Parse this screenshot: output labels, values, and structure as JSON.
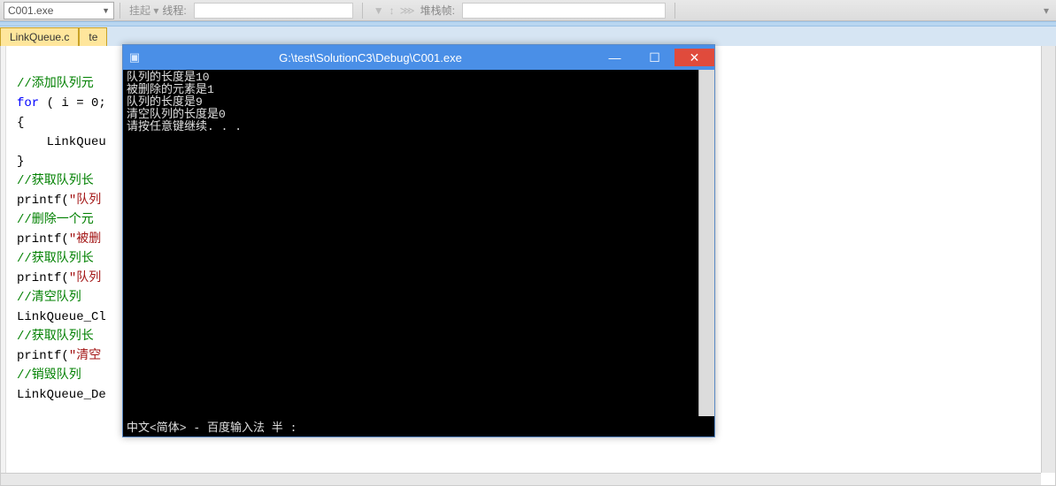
{
  "toolbar": {
    "process_dropdown": "C001.exe",
    "suspend_label": "挂起 ▾",
    "thread_label": "线程:",
    "stackframe_label": "堆栈帧:"
  },
  "tabs": {
    "active": "LinkQueue.c",
    "second": "te"
  },
  "code": {
    "l1": "//添加队列元",
    "l2a": "for",
    "l2b": " ( i = 0;",
    "l3": "{",
    "l4": "    LinkQueu",
    "l5": "}",
    "l6": "//获取队列长",
    "l7a": "printf(",
    "l7b": "\"队列",
    "l8": "//删除一个元",
    "l9a": "printf(",
    "l9b": "\"被删",
    "l10": "//获取队列长",
    "l11a": "printf(",
    "l11b": "\"队列",
    "l12": "//清空队列",
    "l13": "LinkQueue_Cl",
    "l14": "//获取队列长",
    "l15a": "printf(",
    "l15b": "\"清空",
    "l16": "//销毁队列",
    "l17": "LinkQueue_De"
  },
  "console": {
    "title": "G:\\test\\SolutionC3\\Debug\\C001.exe",
    "line1": "队列的长度是10",
    "line2": "被删除的元素是1",
    "line3": "队列的长度是9",
    "line4": "清空队列的长度是0",
    "line5": "请按任意键继续. . .",
    "ime": "中文<简体> - 百度输入法 半 :"
  }
}
